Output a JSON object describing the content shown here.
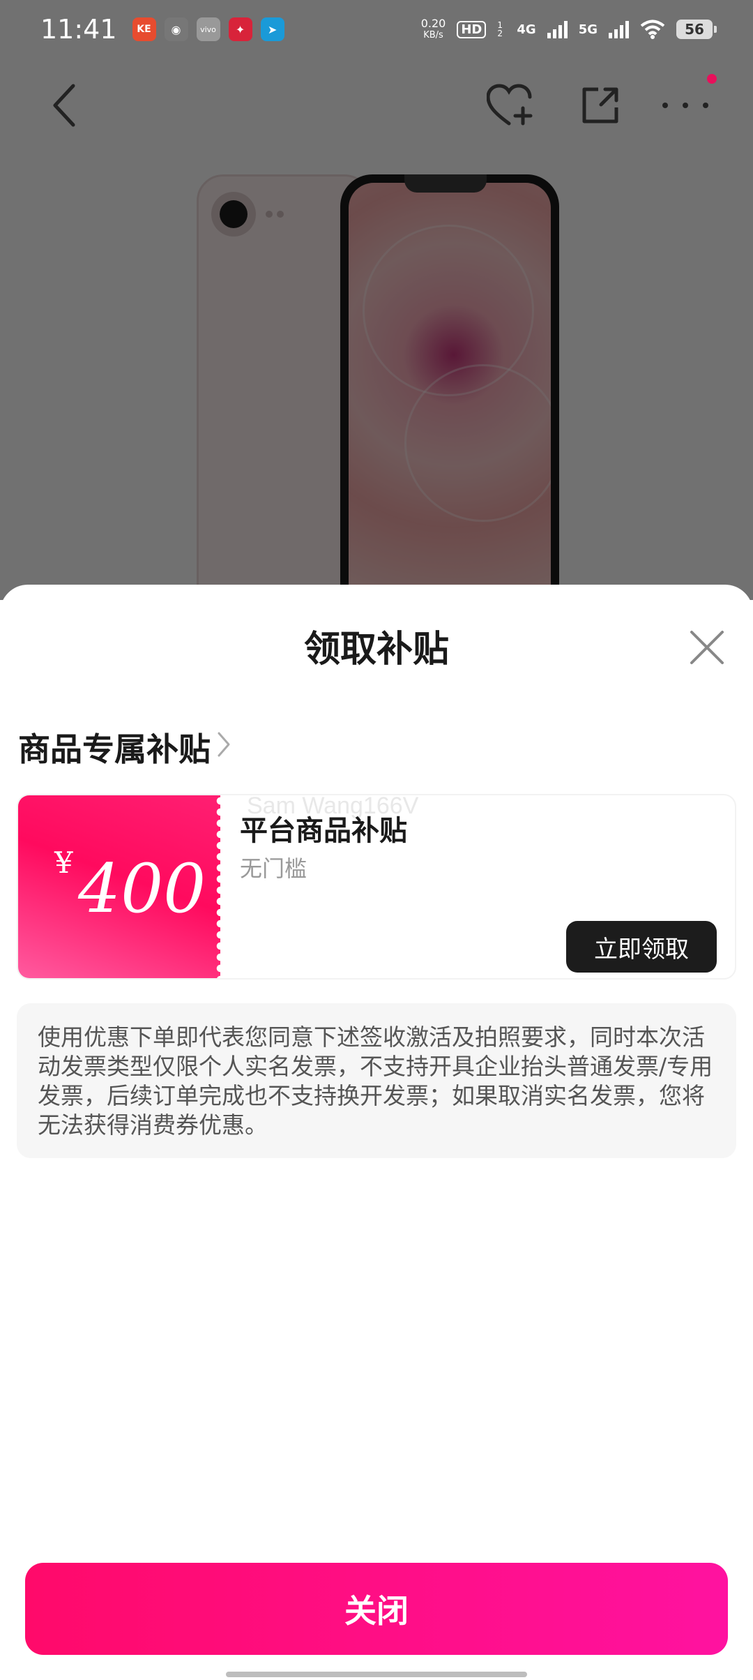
{
  "status_bar": {
    "time": "11:41",
    "apps": [
      {
        "icon": "keep-app-icon",
        "glyph": "KE",
        "color": "#e74c2f"
      },
      {
        "icon": "ai-app-icon",
        "glyph": "◉",
        "color": "#666666"
      },
      {
        "icon": "vivo-app-icon",
        "glyph": "vivo",
        "color": "#888888"
      },
      {
        "icon": "game-app-icon",
        "glyph": "✦",
        "color": "#d8233a"
      },
      {
        "icon": "paper-plane-app-icon",
        "glyph": "➤",
        "color": "#1a9ad8"
      }
    ],
    "net_speed_value": "0.20",
    "net_speed_unit": "KB/s",
    "hd_label": "HD",
    "hd_sub": "1 2",
    "signal_4g": "4G",
    "signal_5g": "5G",
    "battery": "56"
  },
  "sheet": {
    "title": "领取补贴",
    "section_title": "商品专属补贴",
    "coupon": {
      "currency": "¥",
      "amount": "400",
      "name": "平台商品补贴",
      "watermark": "Sam Wang166V",
      "condition": "无门槛",
      "claim_label": "立即领取"
    },
    "notice": "使用优惠下单即代表您同意下述签收激活及拍照要求，同时本次活动发票类型仅限个人实名发票，不支持开具企业抬头普通发票/专用发票，后续订单完成也不支持换开发票；如果取消实名发票，您将无法获得消费券优惠。",
    "close_label": "关闭"
  },
  "colors": {
    "accent_pink": "#ff0a6a",
    "claim_button": "#1c1c1c",
    "notification_dot": "#e8105b"
  }
}
